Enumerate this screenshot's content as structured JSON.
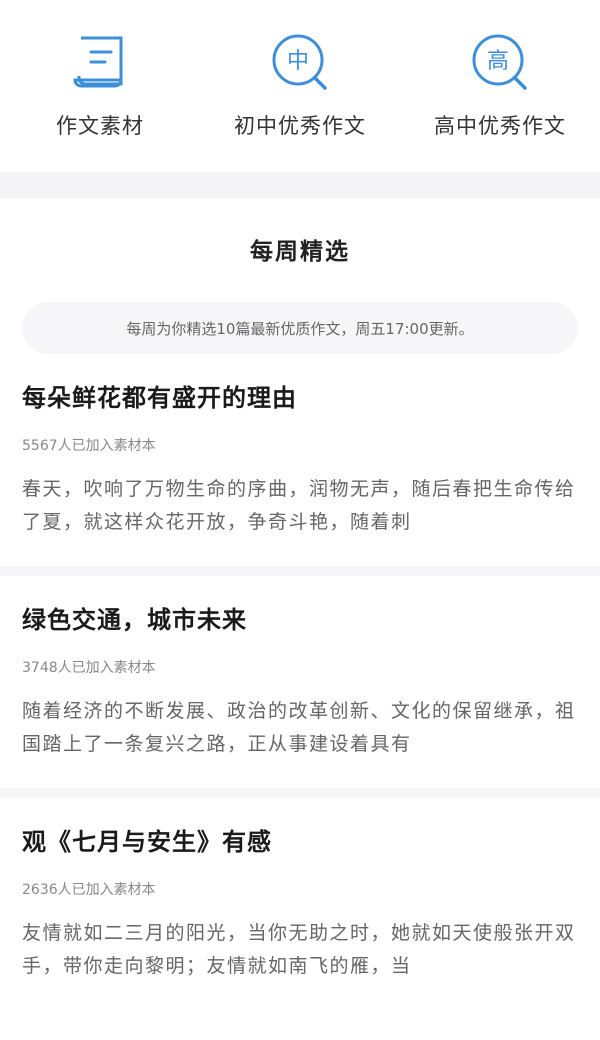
{
  "nav": [
    {
      "label": "作文素材",
      "icon": "document-icon"
    },
    {
      "label": "初中优秀作文",
      "icon": "zhong-search-icon",
      "glyph": "中"
    },
    {
      "label": "高中优秀作文",
      "icon": "gao-search-icon",
      "glyph": "高"
    }
  ],
  "colors": {
    "accent": "#3d8fd9",
    "band": "#f4f4f6"
  },
  "weekly": {
    "title": "每周精选",
    "notice": "每周为你精选10篇最新优质作文，周五17:00更新。"
  },
  "articles": [
    {
      "title": "每朵鲜花都有盛开的理由",
      "meta": "5567人已加入素材本",
      "excerpt": "春天，吹响了万物生命的序曲，润物无声，随后春把生命传给了夏，就这样众花开放，争奇斗艳，随着刺"
    },
    {
      "title": "绿色交通，城市未来",
      "meta": "3748人已加入素材本",
      "excerpt": "随着经济的不断发展、政治的改革创新、文化的保留继承，祖国踏上了一条复兴之路，正从事建设着具有"
    },
    {
      "title": "观《七月与安生》有感",
      "meta": "2636人已加入素材本",
      "excerpt": "友情就如二三月的阳光，当你无助之时，她就如天使般张开双手，带你走向黎明；友情就如南飞的雁，当"
    }
  ]
}
